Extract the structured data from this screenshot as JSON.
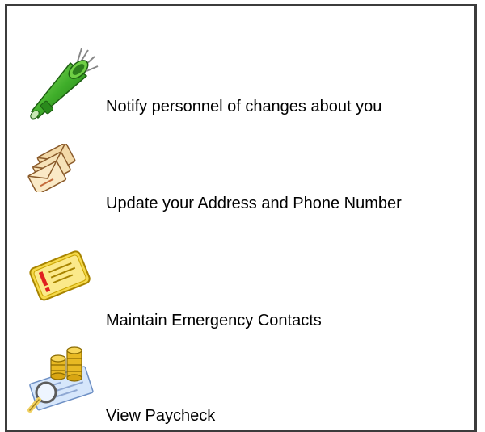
{
  "links": [
    {
      "label": "Notify personnel of changes about you",
      "icon": "megaphone-icon"
    },
    {
      "label": "Update your Address and Phone Number",
      "icon": "envelopes-icon"
    },
    {
      "label": "Maintain Emergency Contacts",
      "icon": "emergency-folder-icon"
    },
    {
      "label": "View Paycheck",
      "icon": "paycheck-coins-magnifier-icon"
    }
  ]
}
